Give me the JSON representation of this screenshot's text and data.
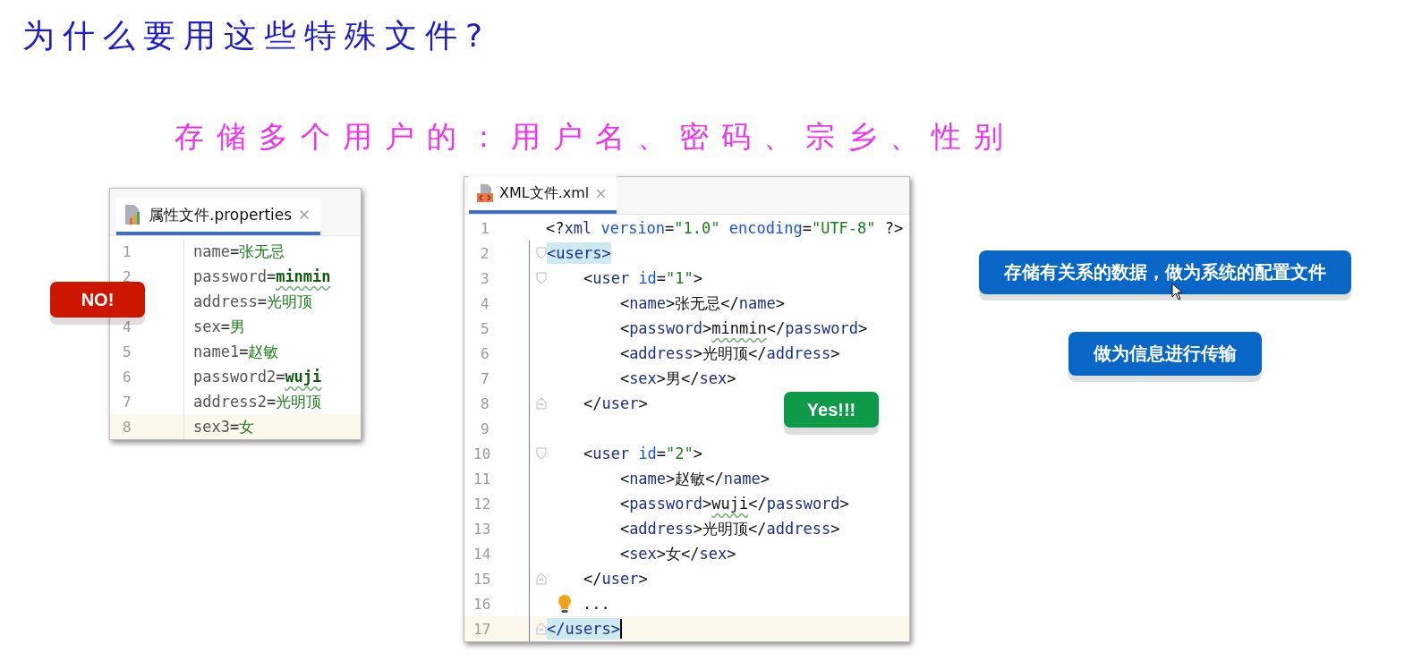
{
  "heading": "为什么要用这些特殊文件?",
  "subheading": "存储多个用户的：用户名、密码、宗乡、性别",
  "properties_editor": {
    "tab": {
      "label": "属性文件.properties",
      "selected": true
    },
    "badge": "NO!",
    "lines": [
      {
        "number": "1",
        "current": false,
        "tokens": [
          {
            "kind": "key",
            "text": "name"
          },
          {
            "kind": "eq",
            "text": "="
          },
          {
            "kind": "value",
            "text": "张无忌"
          }
        ]
      },
      {
        "number": "2",
        "current": false,
        "tokens": [
          {
            "kind": "key",
            "text": "password"
          },
          {
            "kind": "eq",
            "text": "="
          },
          {
            "kind": "value-typo",
            "text": "minmin"
          }
        ]
      },
      {
        "current": false,
        "tokens": [
          {
            "kind": "key",
            "text": "address"
          },
          {
            "kind": "eq",
            "text": "="
          },
          {
            "kind": "value",
            "text": "光明顶"
          }
        ]
      },
      {
        "number": "4",
        "current": false,
        "tokens": [
          {
            "kind": "key",
            "text": "sex"
          },
          {
            "kind": "eq",
            "text": "="
          },
          {
            "kind": "value",
            "text": "男"
          }
        ]
      },
      {
        "number": "5",
        "current": false,
        "tokens": [
          {
            "kind": "key",
            "text": "name1"
          },
          {
            "kind": "eq",
            "text": "="
          },
          {
            "kind": "value",
            "text": "赵敏"
          }
        ]
      },
      {
        "number": "6",
        "current": false,
        "tokens": [
          {
            "kind": "key",
            "text": "password2"
          },
          {
            "kind": "eq",
            "text": "="
          },
          {
            "kind": "value-typo",
            "text": "wuji"
          }
        ]
      },
      {
        "number": "7",
        "current": false,
        "tokens": [
          {
            "kind": "key",
            "text": "address2"
          },
          {
            "kind": "eq",
            "text": "="
          },
          {
            "kind": "value",
            "text": "光明顶"
          }
        ]
      },
      {
        "number": "8",
        "current": true,
        "tokens": [
          {
            "kind": "key",
            "text": "sex3"
          },
          {
            "kind": "eq",
            "text": "="
          },
          {
            "kind": "value",
            "text": "女"
          }
        ]
      }
    ]
  },
  "xml_editor": {
    "tab": {
      "label": "XML文件.xml",
      "selected": true
    },
    "badge": "Yes!!!",
    "lines": [
      {
        "number": "1",
        "current": false,
        "tokens": [
          {
            "kind": "punct",
            "text": "<?"
          },
          {
            "kind": "tag",
            "text": "xml "
          },
          {
            "kind": "attr",
            "text": "version"
          },
          {
            "kind": "punct",
            "text": "="
          },
          {
            "kind": "string",
            "text": "\"1.0\" "
          },
          {
            "kind": "attr",
            "text": "encoding"
          },
          {
            "kind": "punct",
            "text": "="
          },
          {
            "kind": "string",
            "text": "\"UTF-8\" "
          },
          {
            "kind": "punct",
            "text": "?>"
          }
        ]
      },
      {
        "number": "2",
        "current": false,
        "fold_open": true,
        "tokens": [
          {
            "kind": "matched",
            "text": "<users>"
          }
        ]
      },
      {
        "number": "3",
        "current": false,
        "fold_open": true,
        "tokens": [
          {
            "kind": "punct",
            "text": "    <"
          },
          {
            "kind": "tag",
            "text": "user "
          },
          {
            "kind": "attr",
            "text": "id"
          },
          {
            "kind": "punct",
            "text": "="
          },
          {
            "kind": "string",
            "text": "\"1\""
          },
          {
            "kind": "punct",
            "text": ">"
          }
        ]
      },
      {
        "number": "4",
        "current": false,
        "tokens": [
          {
            "kind": "punct",
            "text": "        <"
          },
          {
            "kind": "tag",
            "text": "name"
          },
          {
            "kind": "punct",
            "text": ">"
          },
          {
            "kind": "text",
            "text": "张无忌"
          },
          {
            "kind": "punct",
            "text": "</"
          },
          {
            "kind": "tag",
            "text": "name"
          },
          {
            "kind": "punct",
            "text": ">"
          }
        ]
      },
      {
        "number": "5",
        "current": false,
        "tokens": [
          {
            "kind": "punct",
            "text": "        <"
          },
          {
            "kind": "tag",
            "text": "password"
          },
          {
            "kind": "punct",
            "text": ">"
          },
          {
            "kind": "text-typo",
            "text": "minmin"
          },
          {
            "kind": "punct",
            "text": "</"
          },
          {
            "kind": "tag",
            "text": "password"
          },
          {
            "kind": "punct",
            "text": ">"
          }
        ]
      },
      {
        "number": "6",
        "current": false,
        "tokens": [
          {
            "kind": "punct",
            "text": "        <"
          },
          {
            "kind": "tag",
            "text": "address"
          },
          {
            "kind": "punct",
            "text": ">"
          },
          {
            "kind": "text",
            "text": "光明顶"
          },
          {
            "kind": "punct",
            "text": "</"
          },
          {
            "kind": "tag",
            "text": "address"
          },
          {
            "kind": "punct",
            "text": ">"
          }
        ]
      },
      {
        "number": "7",
        "current": false,
        "tokens": [
          {
            "kind": "punct",
            "text": "        <"
          },
          {
            "kind": "tag",
            "text": "sex"
          },
          {
            "kind": "punct",
            "text": ">"
          },
          {
            "kind": "text",
            "text": "男"
          },
          {
            "kind": "punct",
            "text": "</"
          },
          {
            "kind": "tag",
            "text": "sex"
          },
          {
            "kind": "punct",
            "text": ">"
          }
        ]
      },
      {
        "number": "8",
        "current": false,
        "fold_close": true,
        "tokens": [
          {
            "kind": "punct",
            "text": "    </"
          },
          {
            "kind": "tag",
            "text": "user"
          },
          {
            "kind": "punct",
            "text": ">"
          }
        ]
      },
      {
        "number": "9",
        "current": false
      },
      {
        "number": "10",
        "current": false,
        "fold_open": true,
        "tokens": [
          {
            "kind": "punct",
            "text": "    <"
          },
          {
            "kind": "tag",
            "text": "user "
          },
          {
            "kind": "attr",
            "text": "id"
          },
          {
            "kind": "punct",
            "text": "="
          },
          {
            "kind": "string",
            "text": "\"2\""
          },
          {
            "kind": "punct",
            "text": ">"
          }
        ]
      },
      {
        "number": "11",
        "current": false,
        "tokens": [
          {
            "kind": "punct",
            "text": "        <"
          },
          {
            "kind": "tag",
            "text": "name"
          },
          {
            "kind": "punct",
            "text": ">"
          },
          {
            "kind": "text",
            "text": "赵敏"
          },
          {
            "kind": "punct",
            "text": "</"
          },
          {
            "kind": "tag",
            "text": "name"
          },
          {
            "kind": "punct",
            "text": ">"
          }
        ]
      },
      {
        "number": "12",
        "current": false,
        "tokens": [
          {
            "kind": "punct",
            "text": "        <"
          },
          {
            "kind": "tag",
            "text": "password"
          },
          {
            "kind": "punct",
            "text": ">"
          },
          {
            "kind": "text-typo",
            "text": "wuji"
          },
          {
            "kind": "punct",
            "text": "</"
          },
          {
            "kind": "tag",
            "text": "password"
          },
          {
            "kind": "punct",
            "text": ">"
          }
        ]
      },
      {
        "number": "13",
        "current": false,
        "tokens": [
          {
            "kind": "punct",
            "text": "        <"
          },
          {
            "kind": "tag",
            "text": "address"
          },
          {
            "kind": "punct",
            "text": ">"
          },
          {
            "kind": "text",
            "text": "光明顶"
          },
          {
            "kind": "punct",
            "text": "</"
          },
          {
            "kind": "tag",
            "text": "address"
          },
          {
            "kind": "punct",
            "text": ">"
          }
        ]
      },
      {
        "number": "14",
        "current": false,
        "tokens": [
          {
            "kind": "punct",
            "text": "        <"
          },
          {
            "kind": "tag",
            "text": "sex"
          },
          {
            "kind": "punct",
            "text": ">"
          },
          {
            "kind": "text",
            "text": "女"
          },
          {
            "kind": "punct",
            "text": "</"
          },
          {
            "kind": "tag",
            "text": "sex"
          },
          {
            "kind": "punct",
            "text": ">"
          }
        ]
      },
      {
        "number": "15",
        "current": false,
        "fold_close": true,
        "tokens": [
          {
            "kind": "punct",
            "text": "    </"
          },
          {
            "kind": "tag",
            "text": "user"
          },
          {
            "kind": "punct",
            "text": ">"
          }
        ]
      },
      {
        "number": "16",
        "current": false,
        "hint": true,
        "tokens": [
          {
            "kind": "text",
            "text": "..."
          }
        ]
      },
      {
        "number": "17",
        "current": true,
        "fold_close": true,
        "caret": true,
        "tokens": [
          {
            "kind": "matched",
            "text": "</users>"
          }
        ]
      }
    ]
  },
  "uses": [
    "存储有关系的数据，做为系统的配置文件",
    "做为信息进行传输"
  ]
}
